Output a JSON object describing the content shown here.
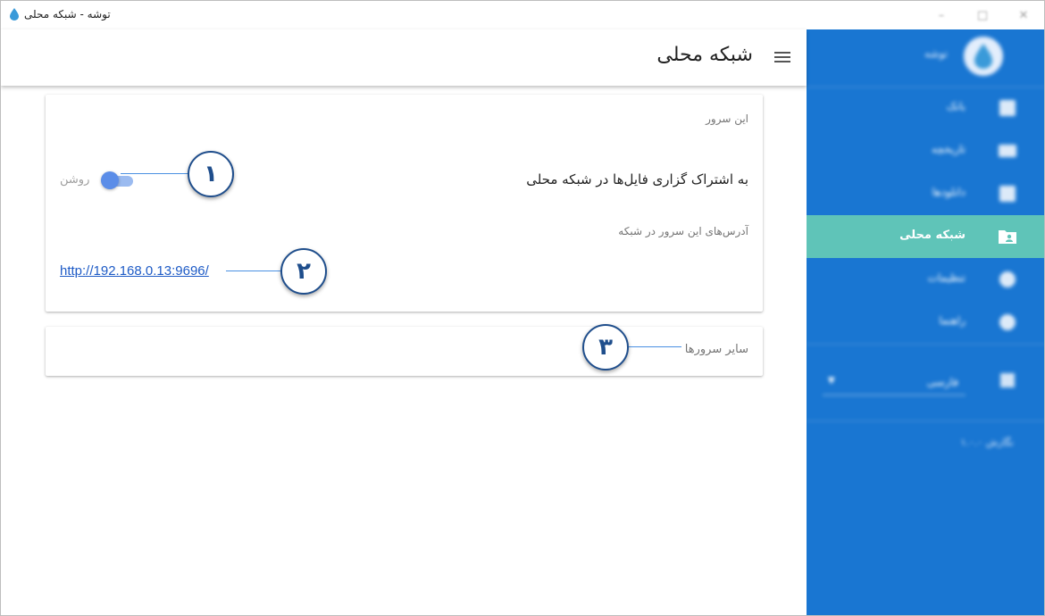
{
  "window": {
    "title": "توشه - شبکه محلی"
  },
  "header": {
    "page_title": "شبکه محلی",
    "menu_icon": "hamburger-menu-icon"
  },
  "this_server": {
    "caption": "این سرور",
    "share_label": "به اشتراک گزاری فایل‌ها در شبکه محلی",
    "toggle_label": "روشن",
    "toggle_on": true,
    "addresses_caption": "آدرس‌های این سرور در شبکه",
    "address": "http://192.168.0.13:9696/"
  },
  "other_servers": {
    "caption": "سایر سرورها"
  },
  "callouts": [
    "۱",
    "۲",
    "۳"
  ],
  "sidebar": {
    "brand": "توشه",
    "items": [
      {
        "label": "بانک",
        "icon": "grid-icon"
      },
      {
        "label": "تاریخچه",
        "icon": "film-icon"
      },
      {
        "label": "دانلودها",
        "icon": "download-icon"
      },
      {
        "label": "شبکه محلی",
        "icon": "network-folder-icon",
        "active": true
      },
      {
        "label": "تنظیمات",
        "icon": "gear-icon"
      },
      {
        "label": "راهنما",
        "icon": "help-icon"
      }
    ],
    "language": "فارسی",
    "version": "نگارش ۱.۰.۰"
  },
  "colors": {
    "sidebar_bg": "#1976d2",
    "active_item_bg": "#5fc4b8",
    "toggle_on": "#5b8de8",
    "link": "#1e5bc6",
    "callout_border": "#1f4e8c"
  }
}
